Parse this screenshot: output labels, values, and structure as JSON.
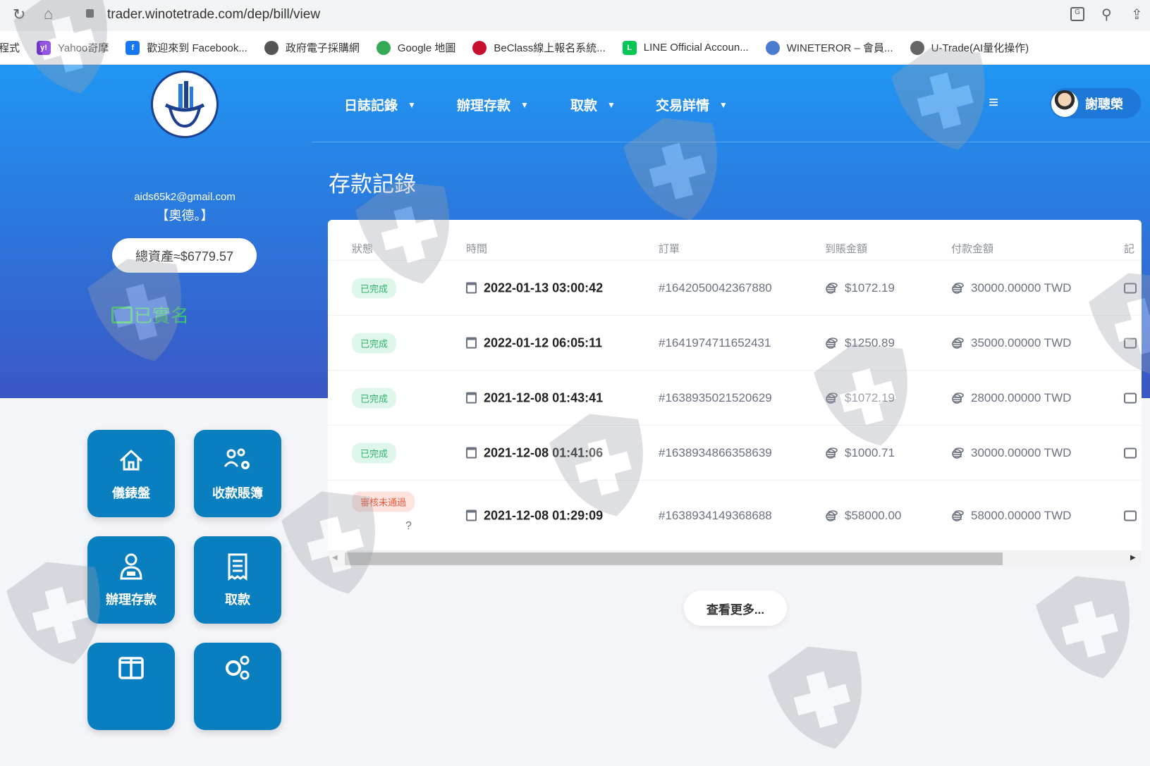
{
  "browser": {
    "url": "trader.winotetrade.com/dep/bill/view",
    "bookmarks": [
      {
        "label": "程式",
        "color": "#888"
      },
      {
        "label": "Yahoo奇摩",
        "color": "#6001d2",
        "glyph": "y!"
      },
      {
        "label": "歡迎來到 Facebook...",
        "color": "#1877f2",
        "glyph": "f"
      },
      {
        "label": "政府電子採購網",
        "color": "#555"
      },
      {
        "label": "Google 地圖",
        "color": "#34a853"
      },
      {
        "label": "BeClass線上報名系統...",
        "color": "#c8102e"
      },
      {
        "label": "LINE Official Accoun...",
        "color": "#06c755",
        "glyph": "L"
      },
      {
        "label": "WINETEROR – 會員...",
        "color": "#4a7bd0"
      },
      {
        "label": "U-Trade(AI量化操作)",
        "color": "#666"
      }
    ]
  },
  "nav": {
    "items": [
      "日誌記錄",
      "辦理存款",
      "取款",
      "交易詳情"
    ],
    "user_name": "謝聰榮"
  },
  "sidebar": {
    "email": "aids65k2@gmail.com",
    "nickname": "【奧德。】",
    "total_assets": "總資產≈$6779.57",
    "verified": "已實名",
    "tiles": [
      {
        "label": "儀錶盤",
        "icon": "home-icon"
      },
      {
        "label": "收款賬簿",
        "icon": "users-gear-icon"
      },
      {
        "label": "辦理存款",
        "icon": "user-deposit-icon"
      },
      {
        "label": "取款",
        "icon": "receipt-icon"
      },
      {
        "label": "",
        "icon": "columns-icon"
      },
      {
        "label": "",
        "icon": "gears-icon"
      }
    ]
  },
  "page": {
    "title": "存款記錄",
    "more_button": "查看更多..."
  },
  "table": {
    "headers": [
      "狀態",
      "時間",
      "訂單",
      "到賬金額",
      "付款金額",
      "記"
    ],
    "rows": [
      {
        "status": "已完成",
        "status_type": "ok",
        "time": "2022-01-13 03:00:42",
        "order": "#1642050042367880",
        "received": "$1072.19",
        "paid": "30000.00000 TWD"
      },
      {
        "status": "已完成",
        "status_type": "ok",
        "time": "2022-01-12 06:05:11",
        "order": "#1641974711652431",
        "received": "$1250.89",
        "paid": "35000.00000 TWD"
      },
      {
        "status": "已完成",
        "status_type": "ok",
        "time": "2021-12-08 01:43:41",
        "order": "#1638935021520629",
        "received": "$1072.19",
        "paid": "28000.00000 TWD"
      },
      {
        "status": "已完成",
        "status_type": "ok",
        "time": "2021-12-08 01:41:06",
        "order": "#1638934866358639",
        "received": "$1000.71",
        "paid": "30000.00000 TWD"
      },
      {
        "status": "審核未通過",
        "status_type": "fail",
        "time": "2021-12-08 01:29:09",
        "order": "#1638934149368688",
        "received": "$58000.00",
        "paid": "58000.00000 TWD"
      }
    ]
  }
}
